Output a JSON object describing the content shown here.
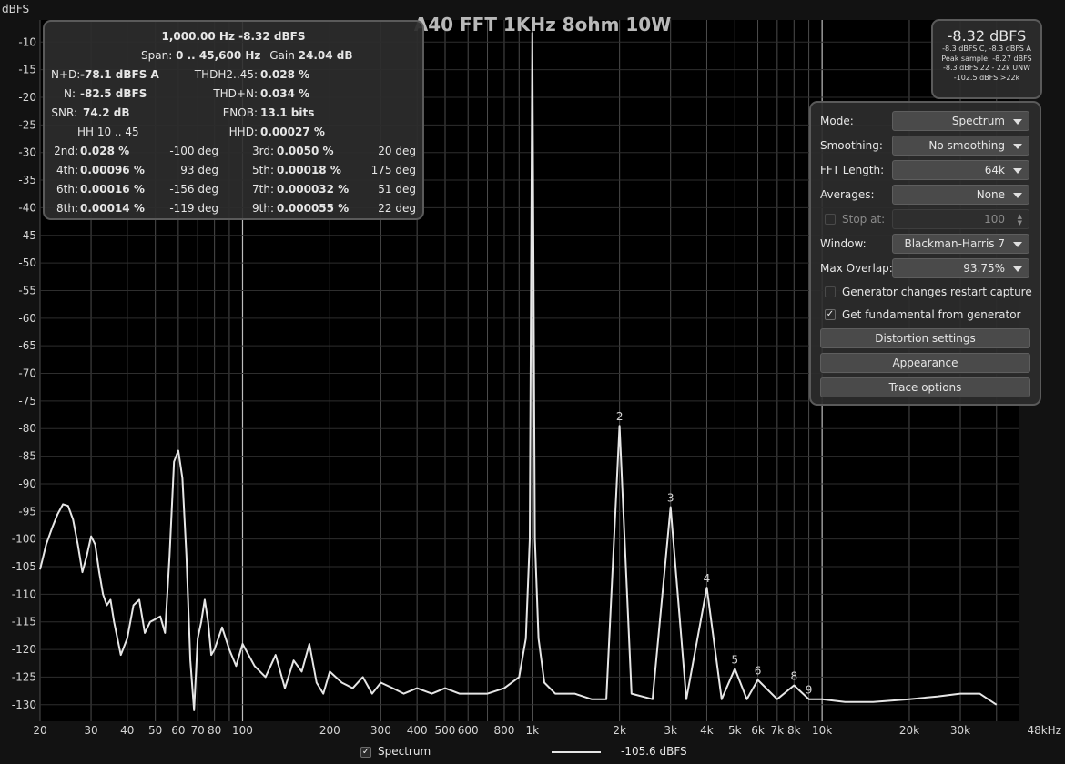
{
  "chart_data": {
    "type": "line",
    "title": "A40 FFT 1KHz 8ohm 10W",
    "ylabel": "dBFS",
    "xlabel": "",
    "x_scale": "log",
    "xlim": [
      20,
      48000
    ],
    "ylim": [
      -133,
      -6
    ],
    "x_ticks": [
      20,
      30,
      40,
      50,
      60,
      70,
      80,
      100,
      200,
      300,
      400,
      500,
      600,
      800,
      1000,
      2000,
      3000,
      4000,
      5000,
      6000,
      7000,
      8000,
      10000,
      20000,
      30000,
      48000
    ],
    "x_tick_labels": [
      "20",
      "30",
      "40",
      "50",
      "60",
      "70",
      "80",
      "100",
      "200",
      "300",
      "400",
      "500",
      "600",
      "800",
      "1k",
      "2k",
      "3k",
      "4k",
      "5k",
      "6k",
      "7k",
      "8k",
      "10k",
      "20k",
      "30k",
      "48kHz"
    ],
    "y_ticks": [
      -10,
      -15,
      -20,
      -25,
      -30,
      -35,
      -40,
      -45,
      -50,
      -55,
      -60,
      -65,
      -70,
      -75,
      -80,
      -85,
      -90,
      -95,
      -100,
      -105,
      -110,
      -115,
      -120,
      -125,
      -130
    ],
    "grid": true,
    "series": [
      {
        "name": "Spectrum",
        "x": [
          20,
          21,
          22,
          23,
          24,
          25,
          26,
          27,
          28,
          29,
          30,
          31,
          32,
          33,
          34,
          35,
          36,
          37,
          38,
          40,
          42,
          44,
          46,
          48,
          50,
          52,
          54,
          56,
          58,
          60,
          62,
          64,
          66,
          68,
          70,
          72,
          74,
          76,
          78,
          80,
          85,
          90,
          95,
          100,
          110,
          120,
          130,
          140,
          150,
          160,
          170,
          180,
          190,
          200,
          220,
          240,
          260,
          280,
          300,
          330,
          360,
          400,
          450,
          500,
          560,
          630,
          700,
          800,
          900,
          950,
          980,
          1000,
          1020,
          1050,
          1100,
          1200,
          1400,
          1600,
          1800,
          2000,
          2200,
          2600,
          3000,
          3400,
          4000,
          4500,
          5000,
          5500,
          6000,
          7000,
          8000,
          9000,
          10000,
          12000,
          15000,
          20000,
          25000,
          30000,
          35000,
          40000
        ],
        "y": [
          -105.5,
          -101,
          -98,
          -95.5,
          -93.7,
          -94,
          -96.5,
          -101,
          -106,
          -103,
          -99.5,
          -101,
          -106,
          -110,
          -112,
          -111,
          -115,
          -118,
          -121,
          -118,
          -112,
          -111,
          -117,
          -115,
          -114.5,
          -114,
          -117,
          -103,
          -86,
          -84,
          -89,
          -103,
          -122,
          -131,
          -118,
          -115,
          -111,
          -115,
          -121,
          -120,
          -116,
          -120,
          -123,
          -119,
          -123,
          -125,
          -121,
          -127,
          -122,
          -124,
          -119,
          -126,
          -128,
          -124,
          -126,
          -127,
          -125,
          -128,
          -126,
          -127,
          -128,
          -127,
          -128,
          -127,
          -128,
          -128,
          -128,
          -127,
          -125,
          -118,
          -100,
          -8.3,
          -100,
          -118,
          -126,
          -128,
          -128,
          -129,
          -129,
          -79.5,
          -128,
          -129,
          -94.2,
          -129,
          -108.8,
          -129,
          -123.5,
          -129,
          -125.5,
          -129,
          -126.5,
          -129,
          -129,
          -129.5,
          -129.5,
          -129,
          -128.5,
          -128,
          -128,
          -130
        ]
      }
    ],
    "harmonic_labels": [
      {
        "label": "2",
        "x": 2000,
        "y": -79.5
      },
      {
        "label": "3",
        "x": 3000,
        "y": -94.2
      },
      {
        "label": "4",
        "x": 4000,
        "y": -108.8
      },
      {
        "label": "5",
        "x": 5000,
        "y": -123.5
      },
      {
        "label": "6",
        "x": 6000,
        "y": -125.5
      },
      {
        "label": "8",
        "x": 8000,
        "y": -126.5
      },
      {
        "label": "9",
        "x": 9000,
        "y": -129
      }
    ]
  },
  "stats": {
    "fundamental": "1,000.00 Hz  -8.32 dBFS",
    "span_label": "Span:",
    "span_value": "0 .. 45,600 Hz",
    "gain_label": "Gain",
    "gain_value": "24.04 dB",
    "nd_label": "N+D:",
    "nd_value": "-78.1 dBFS A",
    "thd_label": "THDH2..45:",
    "thd_value": "0.028 %",
    "n_label": "N:",
    "n_value": "-82.5 dBFS",
    "thdn_label": "THD+N:",
    "thdn_value": "0.034 %",
    "snr_label": "SNR:",
    "snr_value": "74.2 dB",
    "enob_label": "ENOB:",
    "enob_value": "13.1 bits",
    "hh_label": "HH 10 .. 45",
    "hhd_label": "HHD:",
    "hhd_value": "0.00027 %",
    "harmonics": [
      {
        "label": "2nd:",
        "value": "0.028 %",
        "phase": "-100 deg",
        "label2": "3rd:",
        "value2": "0.0050 %",
        "phase2": "20 deg"
      },
      {
        "label": "4th:",
        "value": "0.00096 %",
        "phase": "93 deg",
        "label2": "5th:",
        "value2": "0.00018 %",
        "phase2": "175 deg"
      },
      {
        "label": "6th:",
        "value": "0.00016 %",
        "phase": "-156 deg",
        "label2": "7th:",
        "value2": "0.000032 %",
        "phase2": "51 deg"
      },
      {
        "label": "8th:",
        "value": "0.00014 %",
        "phase": "-119 deg",
        "label2": "9th:",
        "value2": "0.000055 %",
        "phase2": "22 deg"
      }
    ]
  },
  "readout": {
    "main": "-8.32 dBFS",
    "lines": [
      "-8.3 dBFS C, -8.3 dBFS A",
      "Peak sample: -8.27 dBFS",
      "-8.3 dBFS 22 - 22k UNW",
      "-102.5 dBFS >22k"
    ]
  },
  "settings": {
    "mode_label": "Mode:",
    "mode_value": "Spectrum",
    "smoothing_label": "Smoothing:",
    "smoothing_value": "No smoothing",
    "fft_label": "FFT Length:",
    "fft_value": "64k",
    "averages_label": "Averages:",
    "averages_value": "None",
    "stop_label": "Stop at:",
    "stop_value": "100",
    "window_label": "Window:",
    "window_value": "Blackman-Harris 7",
    "overlap_label": "Max Overlap:",
    "overlap_value": "93.75%",
    "restart_label": "Generator changes restart capture",
    "fundamental_label": "Get fundamental from generator",
    "distortion_button": "Distortion settings",
    "appearance_button": "Appearance",
    "trace_button": "Trace options"
  },
  "legend": {
    "checkbox_label": "Spectrum",
    "level": "-105.6 dBFS"
  }
}
